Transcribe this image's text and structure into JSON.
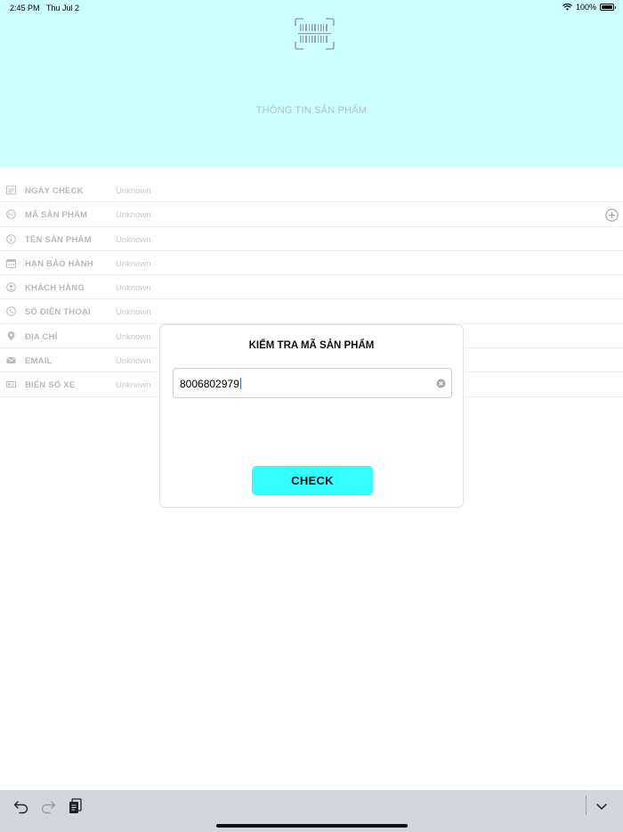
{
  "status_bar": {
    "time": "2:45 PM",
    "date": "Thu Jul 2",
    "battery": "100%",
    "battery_level": 1.0
  },
  "header": {
    "icon": "barcode-scan-icon",
    "title": "THÔNG TIN SẢN PHẨM",
    "background": "#ccffff"
  },
  "info": {
    "rows": [
      {
        "icon": "calendar-list-icon",
        "label": "NGÀY CHECK",
        "value": "Unknown"
      },
      {
        "icon": "product-code-icon",
        "label": "MÃ SẢN PHẨM",
        "value": "Unknown"
      },
      {
        "icon": "info-icon",
        "label": "TÊN SẢN PHẨM",
        "value": "Unknown"
      },
      {
        "icon": "calendar-icon",
        "label": "HẠN BẢO HÀNH",
        "value": "Unknown"
      },
      {
        "icon": "user-icon",
        "label": "KHÁCH HÀNG",
        "value": "Unknown"
      },
      {
        "icon": "phone-icon",
        "label": "SỐ ĐIỆN THOẠI",
        "value": "Unknown"
      },
      {
        "icon": "location-pin-icon",
        "label": "ĐỊA CHỈ",
        "value": "Unknown"
      },
      {
        "icon": "mail-icon",
        "label": "EMAIL",
        "value": "Unknown"
      },
      {
        "icon": "license-plate-icon",
        "label": "BIỂN SỐ XE",
        "value": "Unknown"
      }
    ]
  },
  "dialog": {
    "title": "KIỂM TRA MÃ SẢN PHẨM",
    "code_value": "8006802979",
    "check_label": "CHECK",
    "button_color": "#33ffff"
  },
  "keyboard_bar": {
    "icons": [
      "undo-icon",
      "redo-icon",
      "paste-icon",
      "chevron-down-icon"
    ]
  }
}
